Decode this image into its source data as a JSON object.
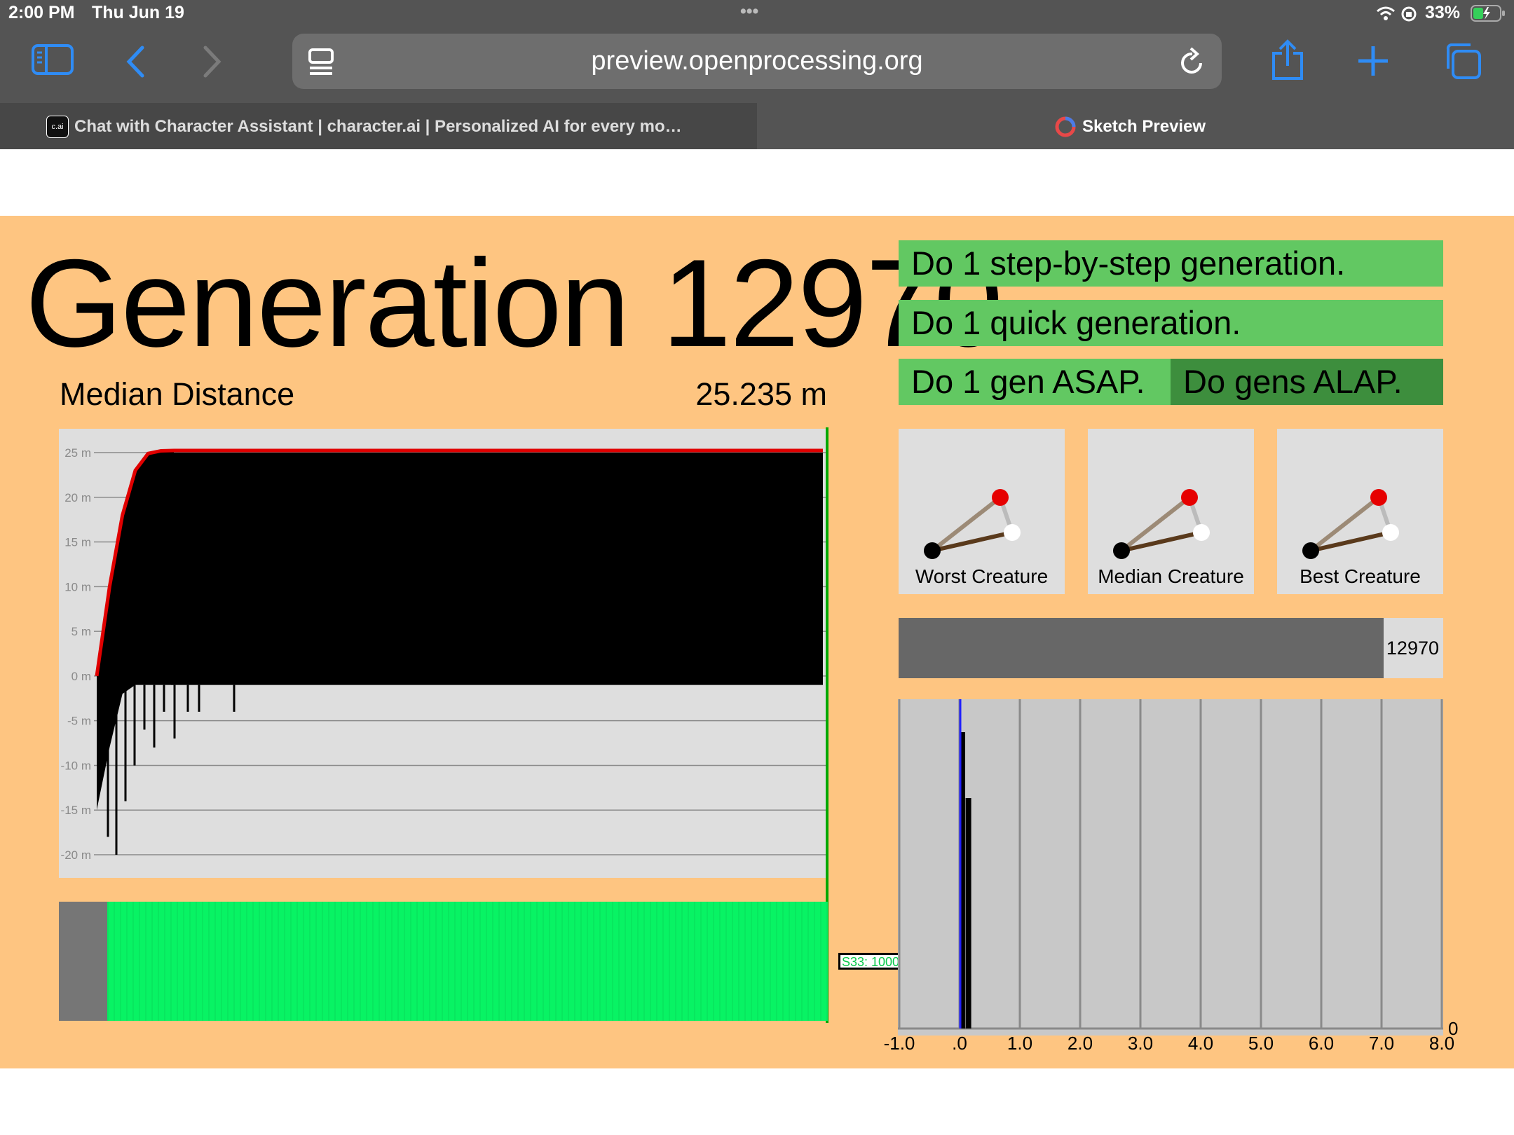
{
  "status_bar": {
    "time": "2:00 PM",
    "date": "Thu Jun 19",
    "dots": "•••",
    "battery": "33%"
  },
  "toolbar": {
    "url": "preview.openprocessing.org"
  },
  "tabs": [
    {
      "icon_text": "c.ai",
      "label": "Chat with Character Assistant | character.ai | Personalized AI for every mo…"
    },
    {
      "label": "Sketch Preview"
    }
  ],
  "sketch": {
    "generation_title": "Generation 12970",
    "buttons": {
      "step": "Do 1 step-by-step generation.",
      "quick": "Do 1 quick generation.",
      "asap": "Do 1 gen ASAP.",
      "alap": "Do gens ALAP."
    },
    "median": {
      "label": "Median Distance",
      "value": "25.235 m"
    },
    "creatures": [
      {
        "label": "Worst Creature"
      },
      {
        "label": "Median Creature"
      },
      {
        "label": "Best Creature"
      }
    ],
    "progress": {
      "value_label": "12970",
      "fraction": 0.89
    },
    "species_tag": "S33: 1000",
    "colors": {
      "page_bg": "#fec581",
      "button_green": "#62c862",
      "button_dark_green": "#3d8e3d",
      "species_green": "#08f364",
      "best_line": "#e00000"
    }
  },
  "chart_data": [
    {
      "type": "line",
      "title": "",
      "ylabel": "",
      "ylim": [
        -20,
        25
      ],
      "y_ticks": [
        "25 m",
        "20 m",
        "15 m",
        "10 m",
        "5 m",
        "0 m",
        "-5 m",
        "-10 m",
        "-15 m",
        "-20 m"
      ],
      "y_tick_values": [
        25,
        20,
        15,
        10,
        5,
        0,
        -5,
        -10,
        -15,
        -20
      ],
      "series": [
        {
          "values": [
            0,
            10,
            18,
            23,
            24.9,
            25.2,
            25.24
          ]
        },
        {
          "values": [
            -15,
            -8,
            -2,
            -1,
            -1,
            -1,
            -1
          ]
        }
      ],
      "grid": true
    },
    {
      "type": "bar",
      "x_ticks": [
        "-1.0",
        ".0",
        "1.0",
        "2.0",
        "3.0",
        "4.0",
        "5.0",
        "6.0",
        "7.0",
        "8.0"
      ],
      "x_tick_values": [
        -1,
        0,
        1,
        2,
        3,
        4,
        5,
        6,
        7,
        8
      ],
      "y_tick": "0",
      "bars": [
        {
          "x": 0.0,
          "value": 0.9
        },
        {
          "x": 0.1,
          "value": 0.7
        }
      ],
      "grid": true
    }
  ]
}
